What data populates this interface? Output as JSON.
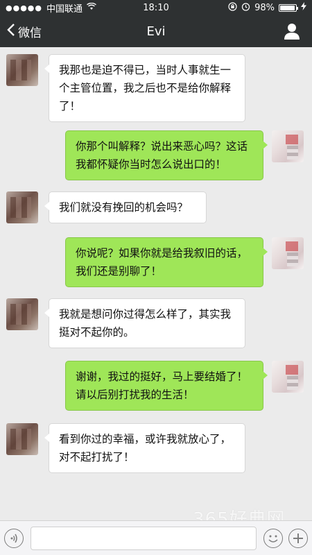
{
  "status_bar": {
    "signal_dots": "●●●●●",
    "carrier": "中国联通",
    "time": "18:10",
    "battery_percent": "98%"
  },
  "nav": {
    "back_label": "微信",
    "title": "Evi"
  },
  "messages": [
    {
      "side": "left",
      "text": "我那也是迫不得已，当时人事就生一个主管位置，我之后也不是给你解释了！"
    },
    {
      "side": "right",
      "text": "你那个叫解释？说出来恶心吗？这话我都怀疑你当时怎么说出口的！"
    },
    {
      "side": "left",
      "text": "我们就没有挽回的机会吗？"
    },
    {
      "side": "right",
      "text": "你说呢？如果你就是给我叙旧的话，我们还是别聊了！"
    },
    {
      "side": "left",
      "text": "我就是想问你过得怎么样了，其实我挺对不起你的。"
    },
    {
      "side": "right",
      "text": "谢谢，我过的挺好，马上要结婚了！请以后别打扰我的生活！"
    },
    {
      "side": "left",
      "text": "看到你过的幸福，或许我就放心了，对不起打扰了！"
    }
  ],
  "input": {
    "value": "",
    "placeholder": ""
  },
  "watermark": "365好典网",
  "colors": {
    "header_bg": "#2e3132",
    "chat_bg": "#ebebeb",
    "bubble_sent": "#9fe658",
    "bubble_received": "#ffffff"
  },
  "icons": [
    "wifi-icon",
    "lock-rotation-icon",
    "alarm-icon",
    "charging-icon",
    "back-chevron-icon",
    "profile-icon",
    "voice-icon",
    "emoji-icon",
    "plus-icon"
  ]
}
